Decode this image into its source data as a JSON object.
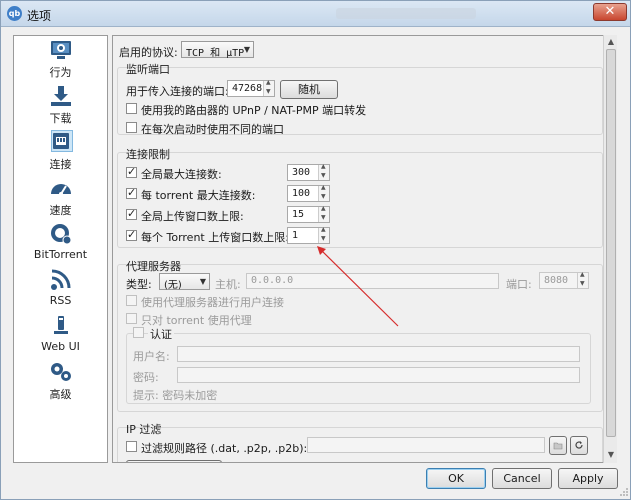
{
  "window": {
    "title": "选项",
    "close_glyph": "✕"
  },
  "sidebar": {
    "items": [
      {
        "label": "行为",
        "icon": "behavior-icon"
      },
      {
        "label": "下载",
        "icon": "download-icon"
      },
      {
        "label": "连接",
        "icon": "connection-icon",
        "active": true
      },
      {
        "label": "速度",
        "icon": "speed-icon"
      },
      {
        "label": "BitTorrent",
        "icon": "bittorrent-icon"
      },
      {
        "label": "RSS",
        "icon": "rss-icon"
      },
      {
        "label": "Web UI",
        "icon": "webui-icon"
      },
      {
        "label": "高级",
        "icon": "advanced-icon"
      }
    ]
  },
  "protocol": {
    "label": "启用的协议:",
    "value": "TCP 和 μTP"
  },
  "listen": {
    "title": "监听端口",
    "port_label": "用于传入连接的端口:",
    "port_value": "47268",
    "random_button": "随机",
    "upnp_label": "使用我的路由器的 UPnP / NAT-PMP 端口转发",
    "diff_port_label": "在每次启动时使用不同的端口"
  },
  "limits": {
    "title": "连接限制",
    "rows": [
      {
        "label": "全局最大连接数:",
        "value": "300"
      },
      {
        "label": "每 torrent 最大连接数:",
        "value": "100"
      },
      {
        "label": "全局上传窗口数上限:",
        "value": "15"
      },
      {
        "label": "每个 Torrent 上传窗口数上限:",
        "value": "1"
      }
    ]
  },
  "proxy": {
    "title": "代理服务器",
    "type_label": "类型:",
    "type_value": "(无)",
    "host_label": "主机:",
    "host_placeholder": "0.0.0.0",
    "port_label": "端口:",
    "port_value": "8080",
    "peer_label": "使用代理服务器进行用户连接",
    "torrent_only_label": "只对 torrent 使用代理",
    "auth_label": "认证",
    "username_label": "用户名:",
    "password_label": "密码:",
    "hint": "提示: 密码未加密"
  },
  "ip_filter": {
    "title": "IP 过滤",
    "path_label": "过滤规则路径 (.dat, .p2p, .p2b):"
  },
  "buttons": {
    "ok": "OK",
    "cancel": "Cancel",
    "apply": "Apply"
  },
  "colors": {
    "accent": "#3f7fc8",
    "arrow": "#d62d2d",
    "active_highlight": "#cde6f7"
  }
}
